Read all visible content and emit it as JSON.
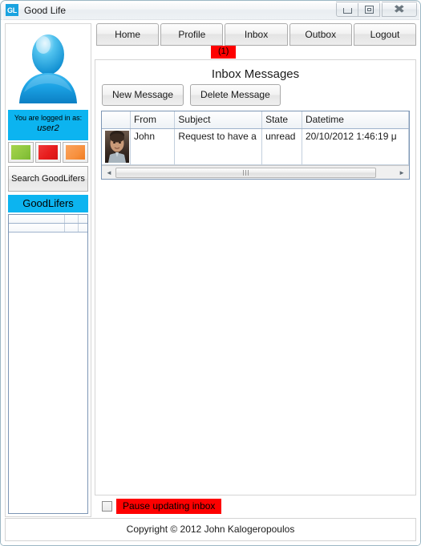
{
  "window": {
    "title": "Good Life",
    "icon_label": "GL",
    "controls": {
      "minimize": "minimize-icon",
      "restore": "restore-icon",
      "close": "close-icon"
    }
  },
  "sidebar": {
    "avatar_icon": "user-avatar-icon",
    "logged_in_label": "You are logged in as:",
    "username": "user2",
    "color_buttons": [
      {
        "name": "green-status-button",
        "color": "#8DC63F"
      },
      {
        "name": "red-status-button",
        "color": "#E71D1D"
      },
      {
        "name": "orange-status-button",
        "color": "#F7913F"
      }
    ],
    "search_button": "Search GoodLifers",
    "goodlifers_header": "GoodLifers",
    "goodlifers_rows": [
      {
        "c1": "",
        "c2": "",
        "c3": ""
      },
      {
        "c1": "",
        "c2": "",
        "c3": ""
      }
    ]
  },
  "tabs": [
    {
      "label": "Home",
      "name": "tab-home",
      "active": false
    },
    {
      "label": "Profile",
      "name": "tab-profile",
      "active": false
    },
    {
      "label": "Inbox",
      "name": "tab-inbox",
      "active": true
    },
    {
      "label": "Outbox",
      "name": "tab-outbox",
      "active": false
    },
    {
      "label": "Logout",
      "name": "tab-logout",
      "active": false
    }
  ],
  "inbox": {
    "badge": "(1)",
    "badge_color": "#FE0000",
    "title": "Inbox Messages",
    "new_message_button": "New Message",
    "delete_message_button": "Delete Message",
    "columns": [
      "",
      "From",
      "Subject",
      "State",
      "Datetime"
    ],
    "rows": [
      {
        "photo": "contact-photo",
        "from": "John",
        "subject": "Request to have a",
        "state": "unread",
        "datetime": "20/10/2012 1:46:19 μ"
      }
    ],
    "scroll_left_icon": "◄",
    "scroll_right_icon": "►"
  },
  "pause": {
    "checked": false,
    "label": "Pause updating inbox",
    "highlight_color": "#FE0000"
  },
  "footer": {
    "copyright": "Copyright © 2012 John Kalogeropoulos"
  }
}
